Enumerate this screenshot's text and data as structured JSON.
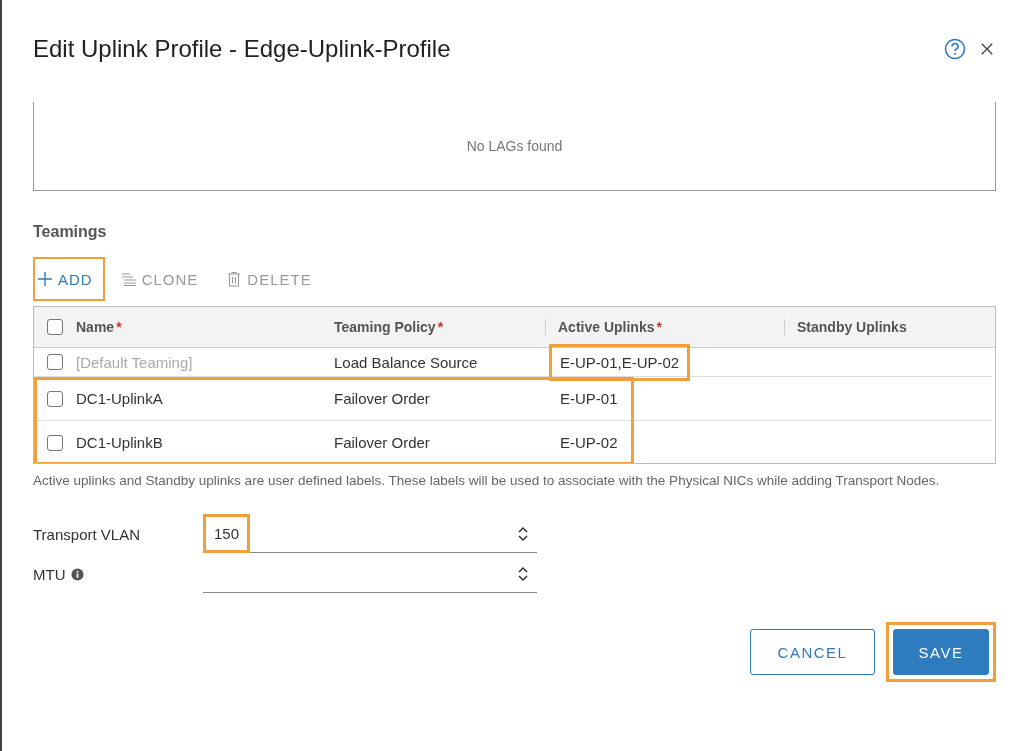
{
  "dialog": {
    "title": "Edit Uplink Profile - Edge-Uplink-Profile"
  },
  "lags": {
    "empty_text": "No LAGs found"
  },
  "teamings": {
    "heading": "Teamings",
    "toolbar": [
      {
        "kind": "add",
        "label": "ADD",
        "disabled": false,
        "highlighted": true
      },
      {
        "kind": "clone",
        "label": "CLONE",
        "disabled": true,
        "highlighted": false
      },
      {
        "kind": "delete",
        "label": "DELETE",
        "disabled": true,
        "highlighted": false
      }
    ],
    "columns": [
      {
        "label": "Name",
        "marker": "*"
      },
      {
        "label": "Teaming Policy",
        "marker": "*"
      },
      {
        "label": "Active Uplinks",
        "marker": "*"
      },
      {
        "label": "Standby Uplinks"
      }
    ],
    "select_all": {
      "checked": false
    },
    "rows": [
      {
        "name": "[Default Teaming]",
        "policy": "Load Balance Source",
        "active": "E-UP-01,E-UP-02",
        "checked": false,
        "disabled": true,
        "row_highlighted": false,
        "active_highlighted": true
      },
      {
        "name": "DC1-UplinkA",
        "policy": "Failover Order",
        "active": "E-UP-01",
        "checked": false,
        "disabled": false,
        "row_highlighted": true,
        "active_highlighted": false
      },
      {
        "name": "DC1-UplinkB",
        "policy": "Failover Order",
        "active": "E-UP-02",
        "checked": false,
        "disabled": false,
        "row_highlighted": true,
        "active_highlighted": false
      }
    ],
    "note": "Active uplinks and Standby uplinks are user defined labels. These labels will be used to associate with the Physical NICs while adding Transport Nodes."
  },
  "fields": [
    {
      "label": "Transport VLAN",
      "value": "150",
      "info": false,
      "highlighted": true
    },
    {
      "label": "MTU",
      "info": true,
      "highlighted": false
    }
  ],
  "buttons": [
    {
      "kind": "secondary",
      "label": "CANCEL",
      "highlighted": false
    },
    {
      "kind": "primary",
      "label": "SAVE",
      "highlighted": true
    }
  ]
}
